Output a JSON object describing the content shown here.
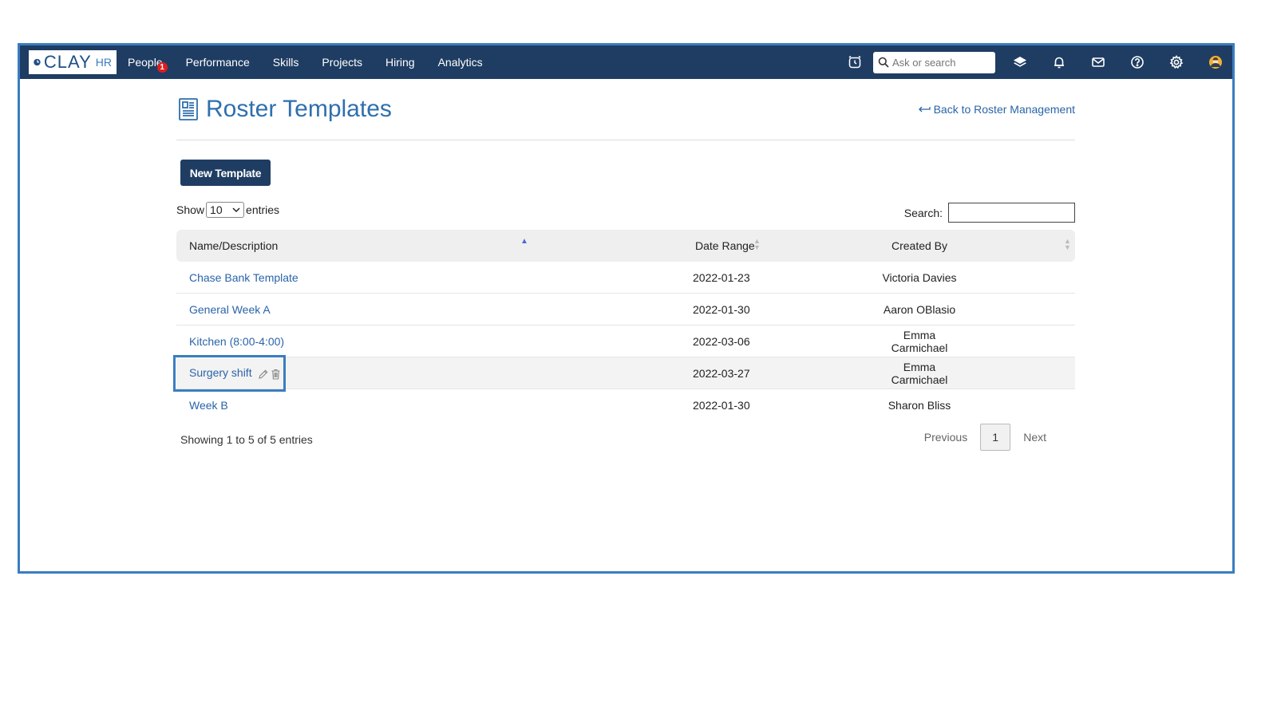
{
  "nav": {
    "logo_main": "CLAY",
    "logo_sub": "HR",
    "items": [
      {
        "label": "People",
        "badge": "1"
      },
      {
        "label": "Performance"
      },
      {
        "label": "Skills"
      },
      {
        "label": "Projects"
      },
      {
        "label": "Hiring"
      },
      {
        "label": "Analytics"
      }
    ],
    "search_placeholder": "Ask or search",
    "icons": [
      "clock-icon",
      "search-icon",
      "layers-icon",
      "bell-icon",
      "mail-icon",
      "help-icon",
      "gear-icon",
      "avatar"
    ]
  },
  "page": {
    "title": "Roster Templates",
    "back_link": "Back to Roster Management",
    "new_button": "New Template",
    "show_label": "Show",
    "entries_value": "10",
    "entries_label": "entries",
    "search_label": "Search:",
    "search_value": ""
  },
  "table": {
    "columns": [
      "Name/Description",
      "Date Range",
      "Created By"
    ],
    "rows": [
      {
        "name": "Chase Bank Template",
        "date": "2022-01-23",
        "created_by": "Victoria Davies"
      },
      {
        "name": "General Week A",
        "date": "2022-01-30",
        "created_by": "Aaron OBlasio"
      },
      {
        "name": "Kitchen (8:00-4:00)",
        "date": "2022-03-06",
        "created_by": "Emma Carmichael"
      },
      {
        "name": "Surgery shift",
        "date": "2022-03-27",
        "created_by": "Emma Carmichael"
      },
      {
        "name": "Week B",
        "date": "2022-01-30",
        "created_by": "Sharon Bliss"
      }
    ],
    "info": "Showing 1 to 5 of 5 entries",
    "pagination": {
      "previous": "Previous",
      "current": "1",
      "next": "Next"
    }
  },
  "colors": {
    "nav_bg": "#1f3d63",
    "link": "#2a64a8",
    "accent": "#3a7dc0",
    "badge": "#e01d1d"
  }
}
